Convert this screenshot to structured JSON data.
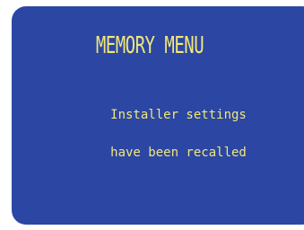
{
  "screen": {
    "title": "MEMORY MENU",
    "message_line1": "Installer settings",
    "message_line2": "have been recalled"
  },
  "colors": {
    "background": "#2b46a3",
    "text": "#f1e77a"
  }
}
